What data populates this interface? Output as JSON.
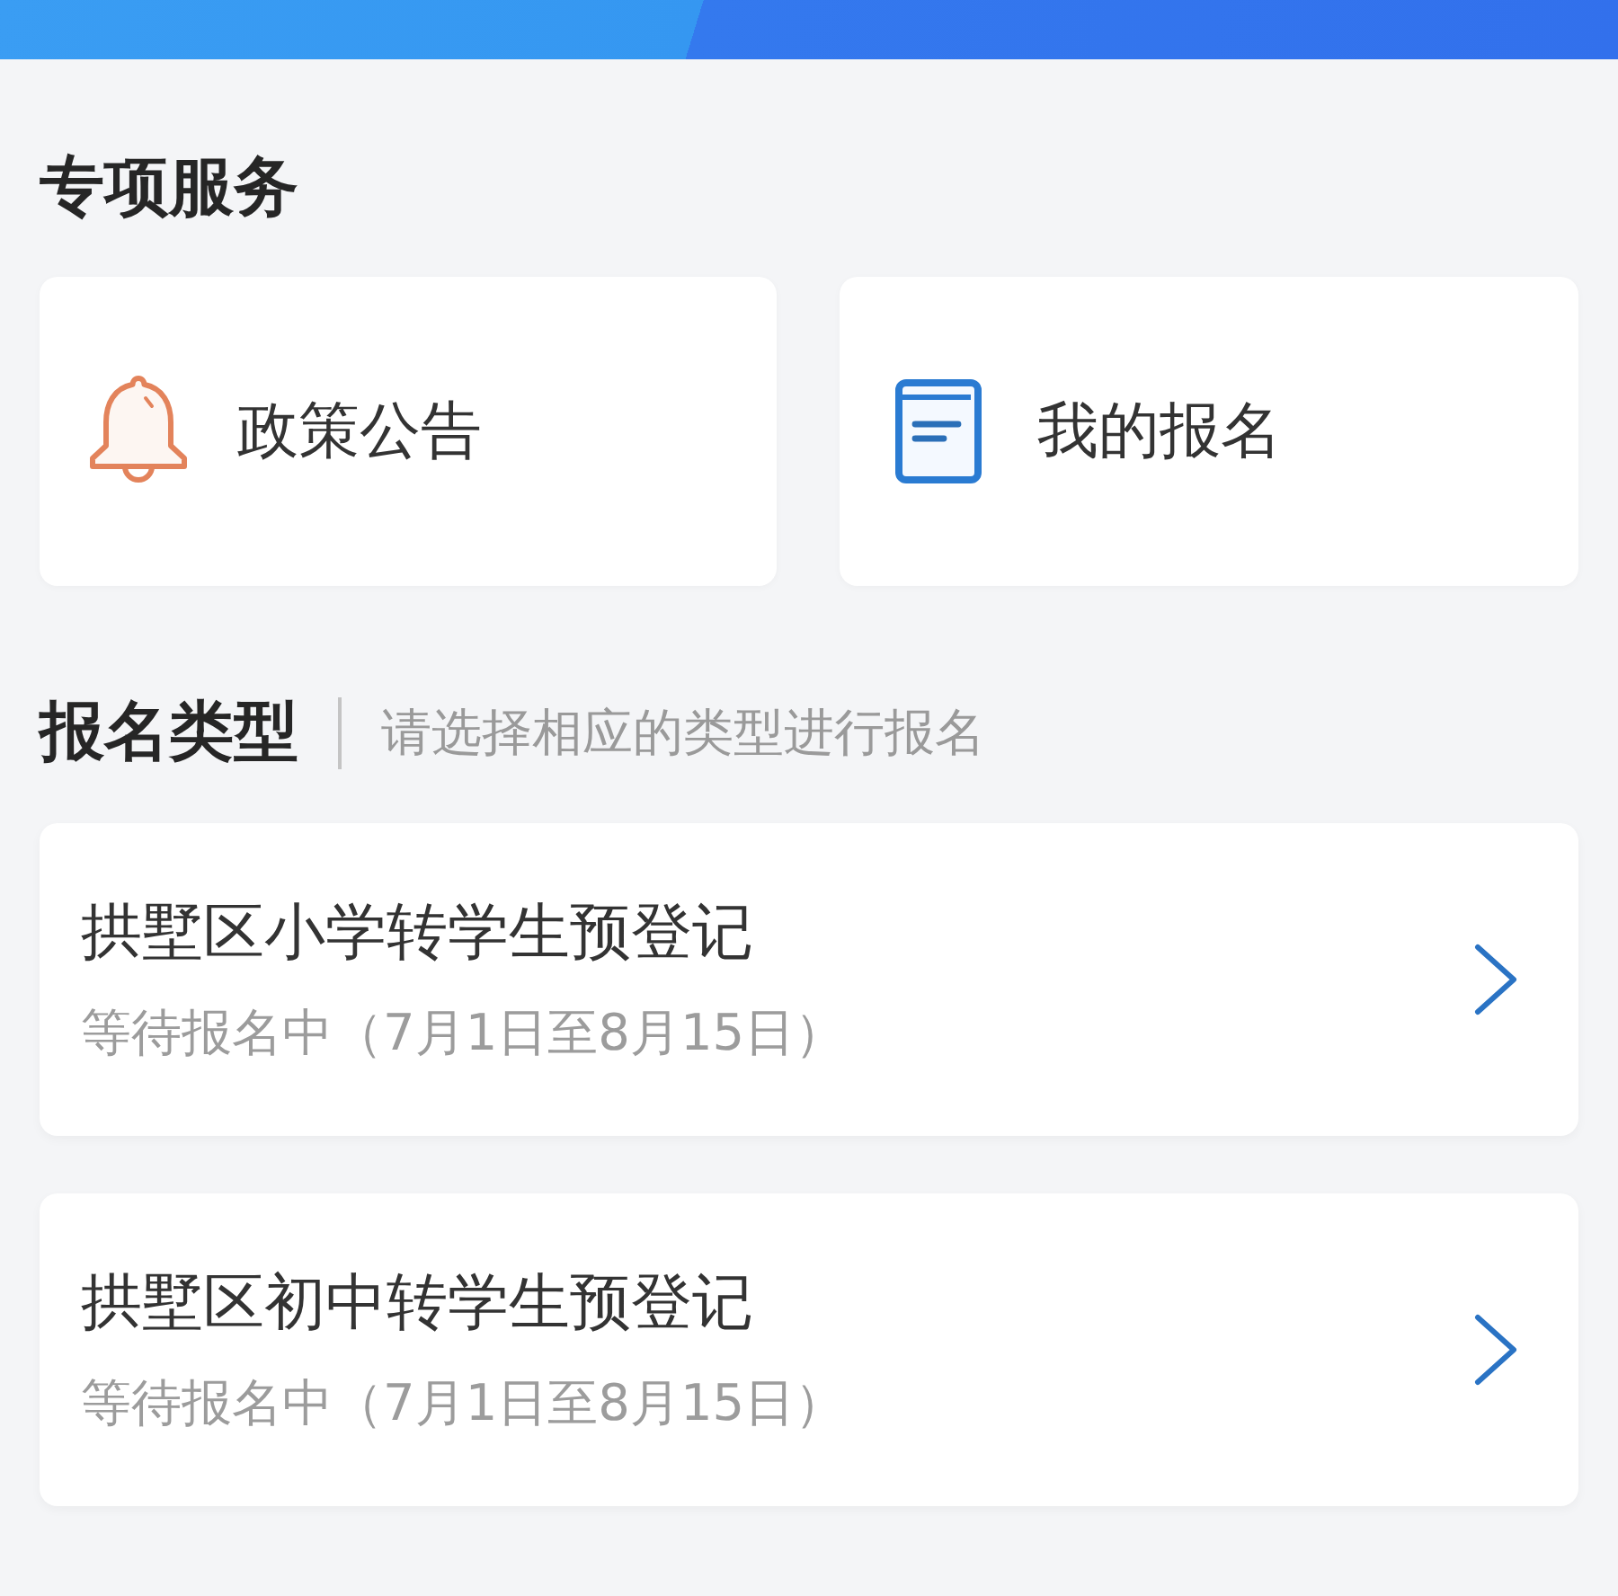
{
  "services": {
    "title": "专项服务",
    "items": [
      {
        "kind": "bell",
        "label": "政策公告"
      },
      {
        "kind": "document",
        "label": "我的报名"
      }
    ]
  },
  "registration": {
    "title": "报名类型",
    "hint": "请选择相应的类型进行报名",
    "items": [
      {
        "title": "拱墅区小学转学生预登记",
        "status": "等待报名中（7月1日至8月15日）"
      },
      {
        "title": "拱墅区初中转学生预登记",
        "status": "等待报名中（7月1日至8月15日）"
      }
    ]
  }
}
